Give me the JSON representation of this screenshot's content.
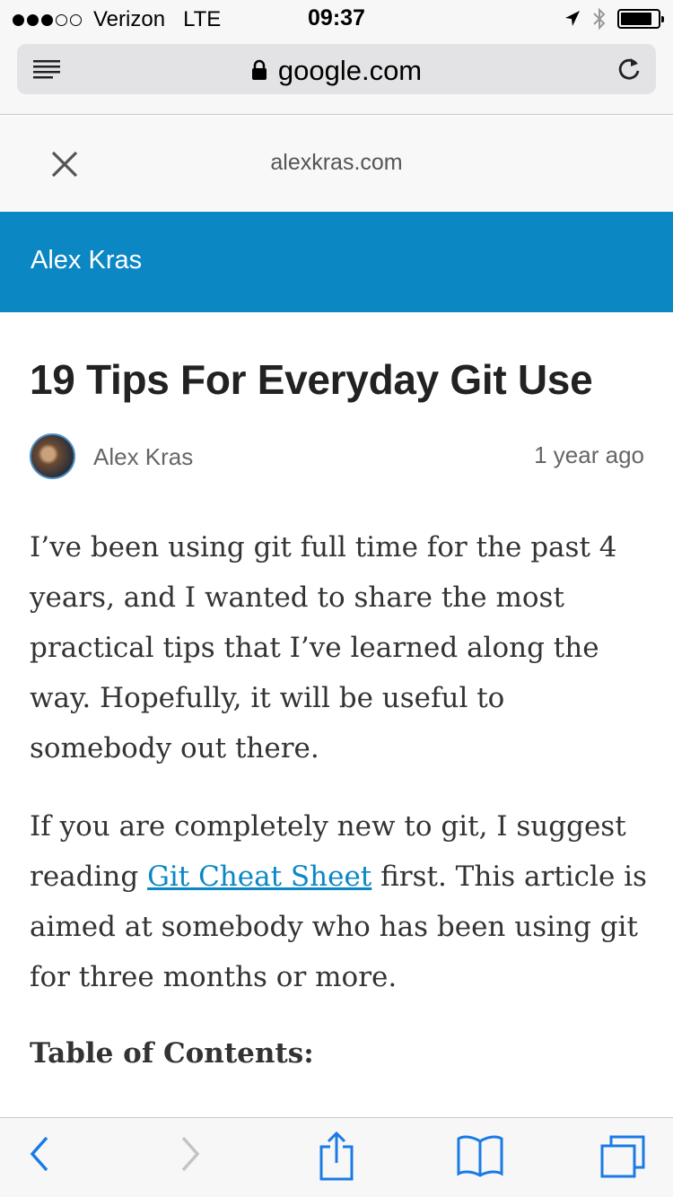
{
  "status_bar": {
    "carrier": "Verizon",
    "network": "LTE",
    "time": "09:37",
    "signal_bars_filled": 3,
    "signal_bars_total": 5
  },
  "browser": {
    "url": "google.com",
    "icons": {
      "menu": "reader-lines-icon",
      "lock": "lock-icon",
      "reload": "reload-icon"
    }
  },
  "amp_header": {
    "domain": "alexkras.com",
    "close_icon": "close-icon"
  },
  "site": {
    "title": "Alex Kras",
    "header_color": "#0b87c4"
  },
  "article": {
    "title": "19 Tips For Everyday Git Use",
    "author": "Alex Kras",
    "posted": "1 year ago",
    "paragraph_1": "I’ve been using git full time for the past 4 years, and I wanted to share the most practical tips that I’ve learned along the way. Hopefully, it will be useful to somebody out there.",
    "paragraph_2_before": "If you are completely new to git, I suggest reading ",
    "paragraph_2_link": "Git Cheat Sheet",
    "paragraph_2_after": " first. This article is aimed at somebody who has been using git for three months or more.",
    "toc_heading": "Table of Contents:"
  },
  "toolbar": {
    "items": [
      "back-icon",
      "forward-icon",
      "share-icon",
      "bookmarks-icon",
      "tabs-icon"
    ],
    "accent": "#1a7be6"
  }
}
